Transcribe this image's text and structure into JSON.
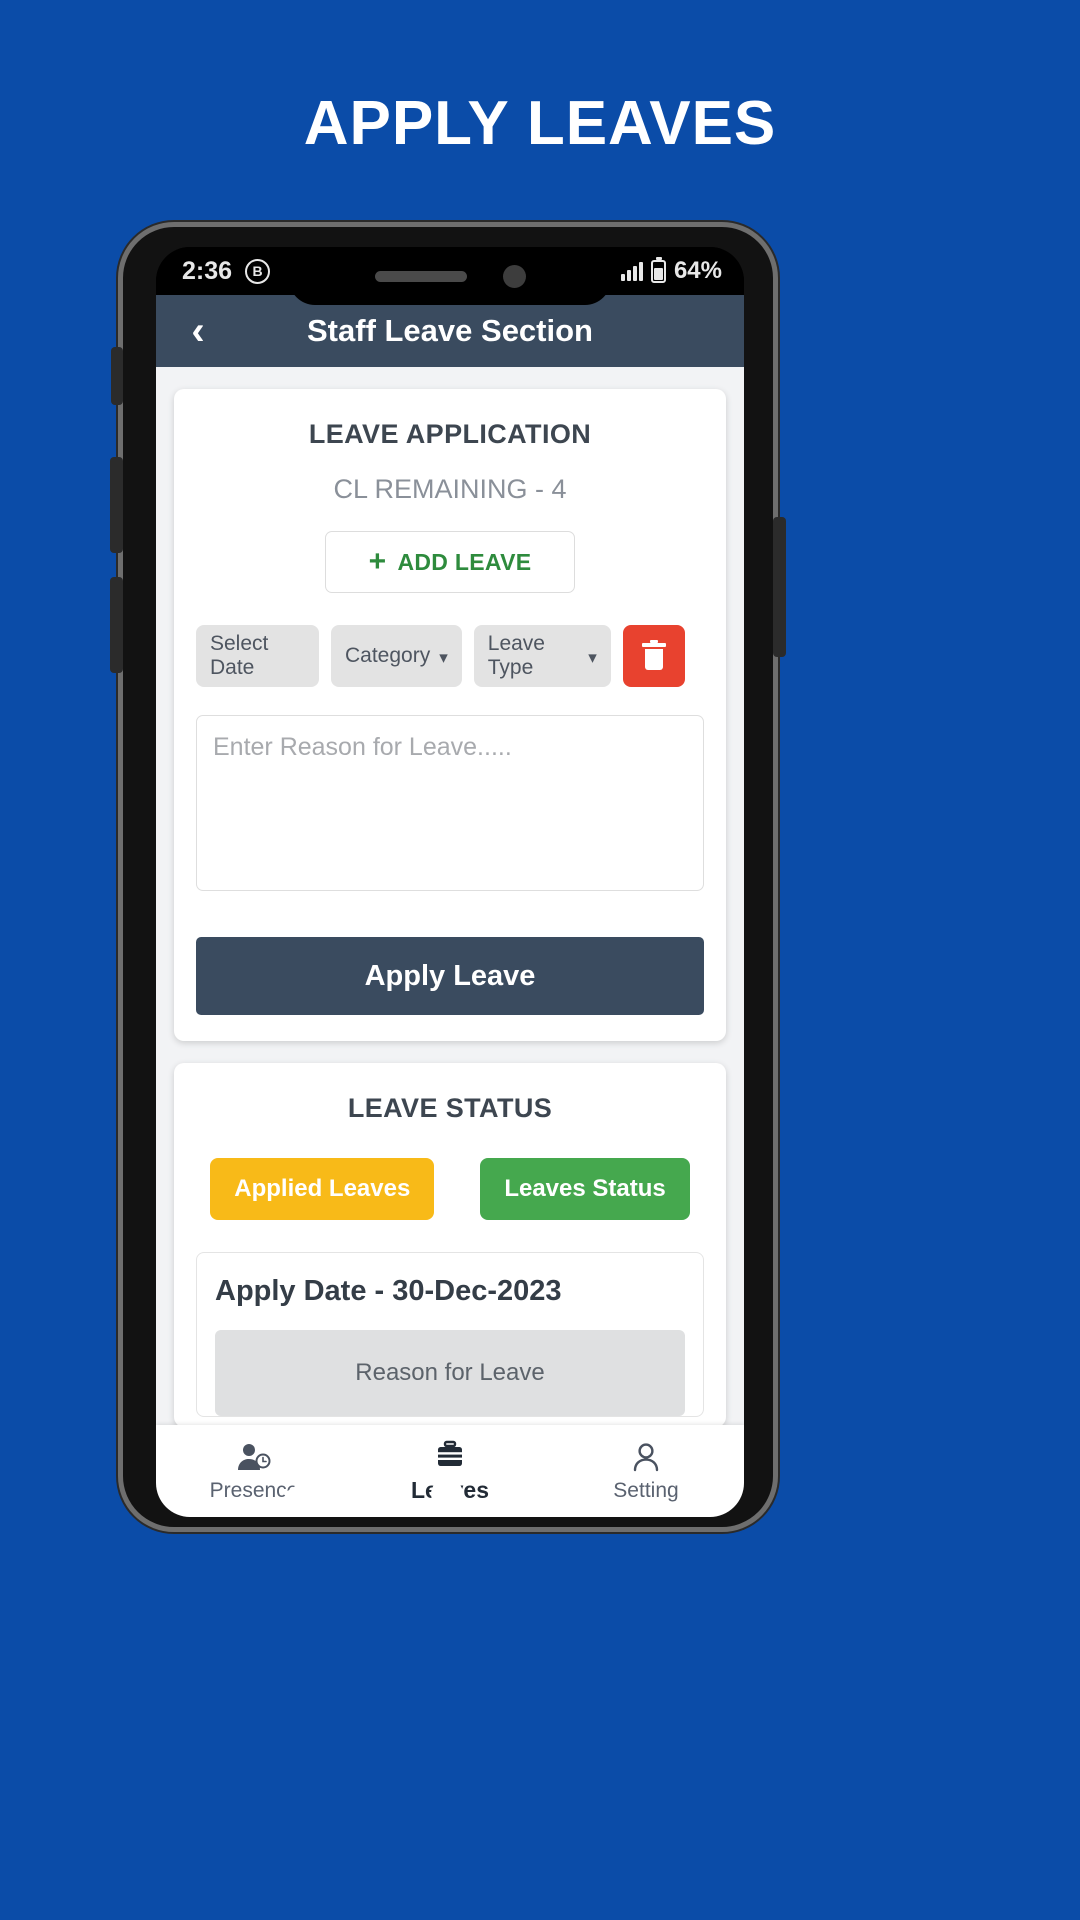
{
  "banner": {
    "title": "APPLY LEAVES",
    "background": "#0B4CA8"
  },
  "statusbar": {
    "time": "2:36",
    "whatsapp_icon_letter": "B",
    "battery_percent": "64%"
  },
  "appbar": {
    "title": "Staff Leave Section",
    "back_icon": "chevron-left-icon",
    "background": "#3A4B5F"
  },
  "leave_application": {
    "title": "LEAVE APPLICATION",
    "cl_remaining": "CL REMAINING - 4",
    "add_leave_label": "ADD LEAVE",
    "add_leave_plus": "+",
    "add_leave_color": "#2E8B3D",
    "chips": {
      "select_date": "Select Date",
      "category": "Category",
      "leave_type": "Leave Type",
      "caret": "⌄"
    },
    "delete_color": "#E8422F",
    "reason_placeholder": "Enter Reason for Leave.....",
    "reason_value": "",
    "apply_button_label": "Apply Leave",
    "apply_button_color": "#3A4B5F"
  },
  "leave_status": {
    "title": "LEAVE STATUS",
    "applied_leaves_label": "Applied Leaves",
    "applied_leaves_color": "#F8BA18",
    "leaves_status_label": "Leaves Status",
    "leaves_status_color": "#45A84E",
    "entry": {
      "apply_date_label": "Apply Date - 30-Dec-2023",
      "reason_header": "Reason for Leave"
    }
  },
  "bottom_nav": {
    "items": [
      {
        "label": "Presence",
        "icon": "person-clock-icon",
        "active": false
      },
      {
        "label": "Leaves",
        "icon": "briefcase-icon",
        "active": true
      },
      {
        "label": "Setting",
        "icon": "person-icon",
        "active": false
      }
    ]
  },
  "android_nav": {
    "back": "triangle-back-icon",
    "home": "circle-home-icon",
    "recents": "square-recents-icon"
  }
}
